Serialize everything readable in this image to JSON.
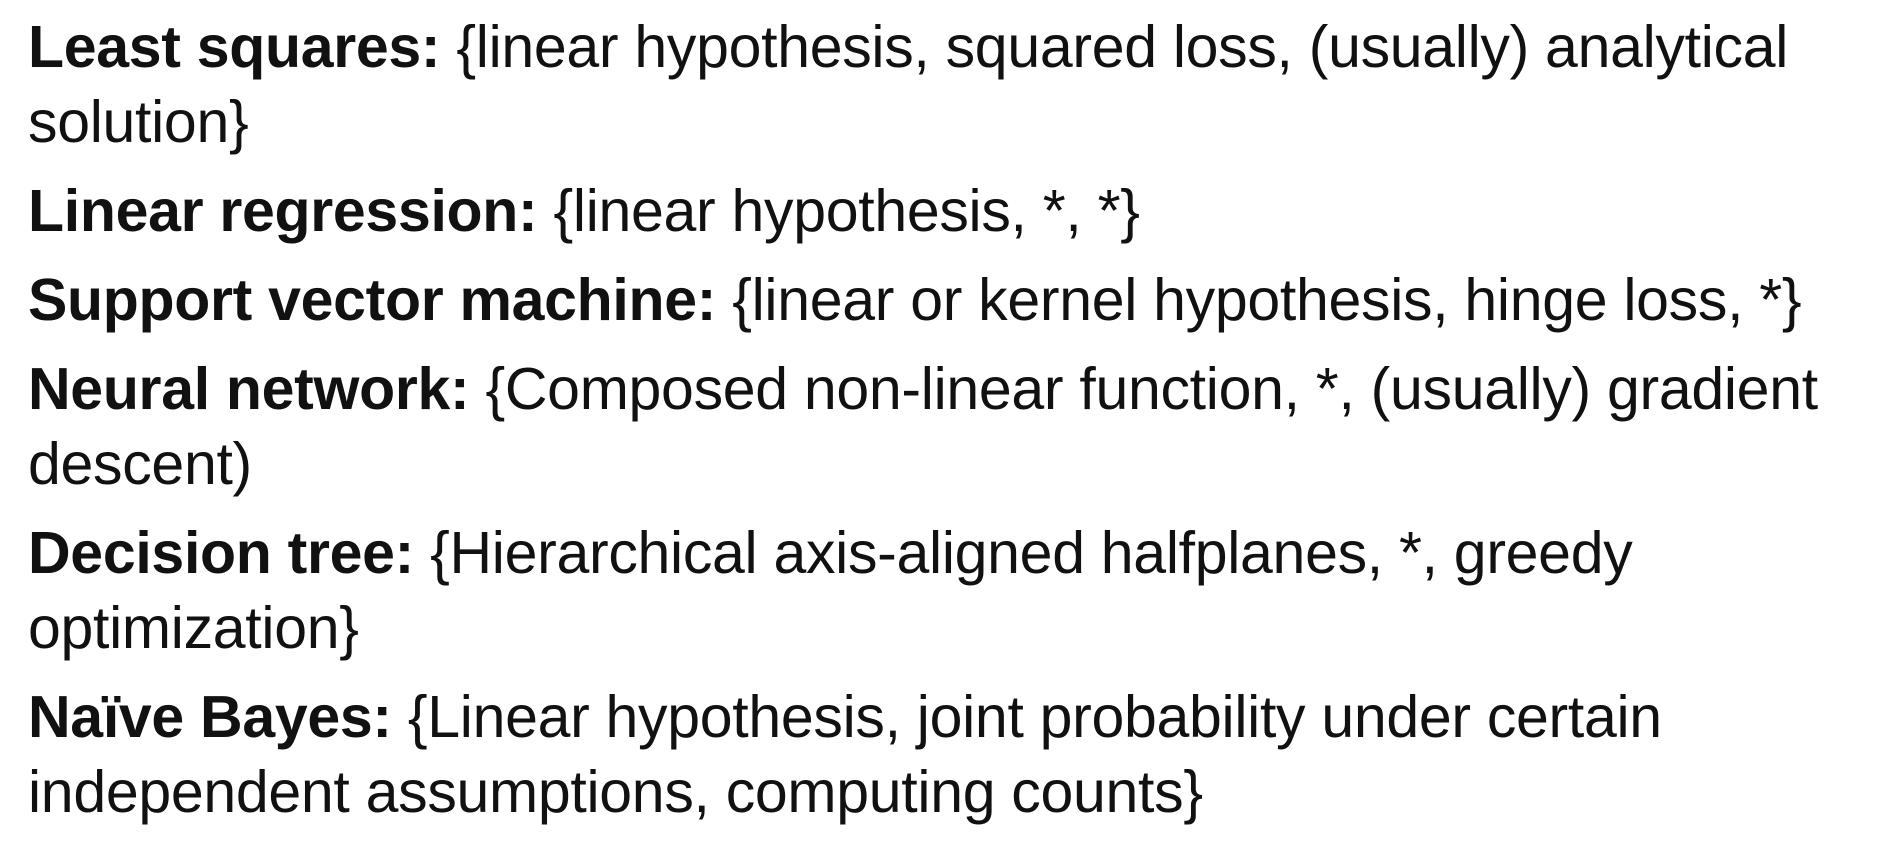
{
  "entries": [
    {
      "term": "Least squares:",
      "description": "{linear hypothesis, squared loss, (usually) analytical solution}"
    },
    {
      "term": "Linear regression:",
      "description": "{linear hypothesis, *, *}"
    },
    {
      "term": "Support vector machine:",
      "description": "{linear or kernel hypothesis, hinge loss, *}"
    },
    {
      "term": "Neural network:",
      "description": "{Composed non-linear function, *, (usually) gradient descent)"
    },
    {
      "term": "Decision tree:",
      "description": "{Hierarchical axis-aligned halfplanes, *, greedy optimization}"
    },
    {
      "term": "Naïve Bayes:",
      "description": "{Linear hypothesis, joint probability under certain independent assumptions, computing counts}"
    }
  ]
}
